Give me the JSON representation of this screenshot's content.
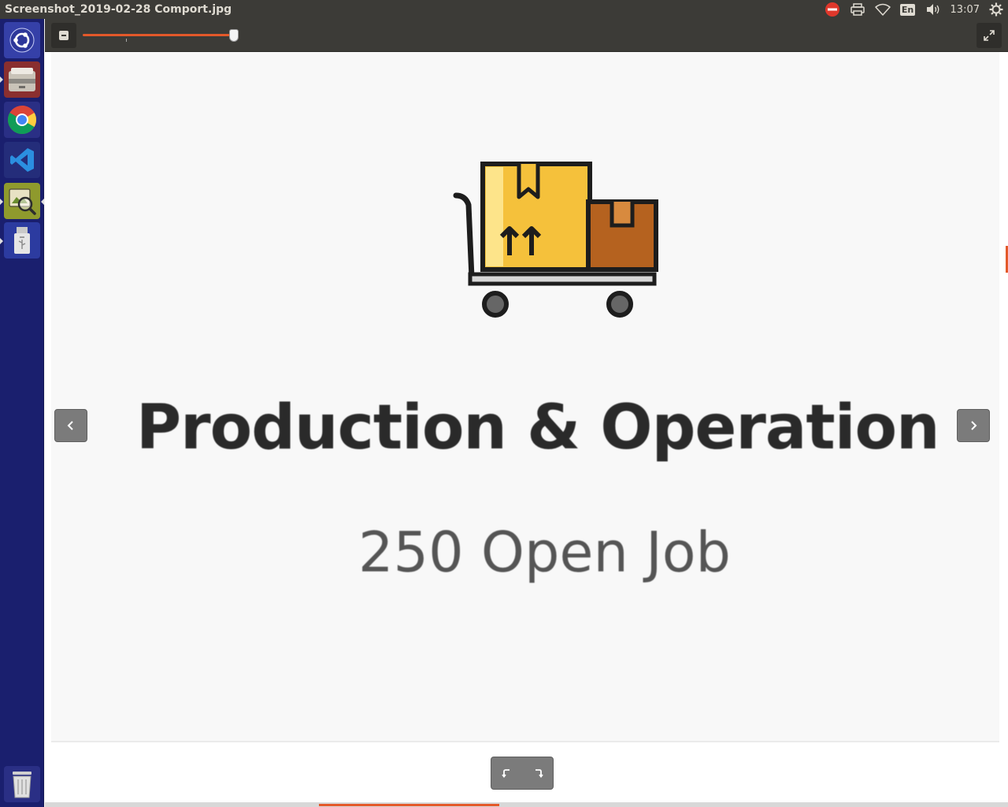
{
  "window": {
    "title": "Screenshot_2019-02-28 Comport.jpg"
  },
  "panel": {
    "keyboard_layout": "En",
    "clock": "13:07",
    "indicators": [
      "do-not-disturb-icon",
      "printer-icon",
      "wifi-icon",
      "keyboard-layout",
      "volume-icon",
      "clock",
      "settings-gear-icon"
    ]
  },
  "launcher": {
    "items": [
      {
        "name": "ubuntu-dash-icon",
        "running": false
      },
      {
        "name": "files-icon",
        "running": true
      },
      {
        "name": "chrome-icon",
        "running": false
      },
      {
        "name": "vscode-icon",
        "running": false
      },
      {
        "name": "image-viewer-icon",
        "running": true,
        "active": true
      },
      {
        "name": "usb-drive-icon",
        "running": true
      },
      {
        "name": "trash-icon",
        "running": false
      }
    ]
  },
  "viewer": {
    "zoom_fraction": 0.98,
    "image": {
      "category": "Production & Operation",
      "job_count": "250 Open Job",
      "illustration": "cart-with-boxes-icon"
    },
    "image_position_fraction": 0.3
  },
  "colors": {
    "accent": "#e3592a",
    "launcher_bg": "#1a1f6e",
    "panel_bg": "#3c3b37",
    "box_yellow": "#f5c13b",
    "box_brown": "#b5621f"
  }
}
